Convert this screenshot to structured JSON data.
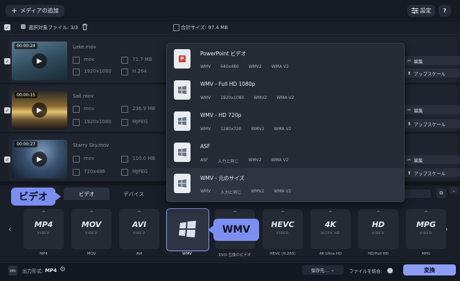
{
  "toolbar": {
    "add_media": "メディアの追加",
    "settings": "設定",
    "help": "?"
  },
  "selection": {
    "label": "選択対象ファイル: 3/3",
    "total": "合計サイズ: 97.4 MB"
  },
  "files": [
    {
      "time": "00:00:24",
      "name": "Lake.mov",
      "container": "mov",
      "resolution": "1920x1080",
      "size": "71.7 MB",
      "codec": "H.264"
    },
    {
      "time": "00:00:15",
      "name": "Sail.mov",
      "container": "mov",
      "resolution": "1920x1080",
      "size": "236.9 MB",
      "codec": "MJPEG"
    },
    {
      "time": "00:00:27",
      "name": "Starry Sky.mov",
      "container": "mov",
      "resolution": "720x486",
      "size": "110.0 MB",
      "codec": "MJPEG"
    }
  ],
  "row_actions": {
    "edit": "編集",
    "upscale": "アップスケール"
  },
  "dropdown": [
    {
      "title": "PowerPoint ビデオ",
      "specs": [
        "WMV",
        "640x480",
        "WMV2",
        "WMA V2"
      ]
    },
    {
      "title": "WMV - Full HD 1080p",
      "specs": [
        "WMV",
        "1920x1080",
        "WMV2",
        "WMA V2"
      ]
    },
    {
      "title": "WMV - HD 720p",
      "specs": [
        "WMV",
        "1280x720",
        "WMV2",
        "WMA V2"
      ]
    },
    {
      "title": "ASF",
      "specs": [
        "ASF",
        "入力と同じ",
        "WMV2",
        "WMA V2"
      ]
    },
    {
      "title": "WMV - 元のサイズ",
      "specs": [
        "WMV",
        "入力と同じ",
        "WMV2",
        "WMA V2"
      ]
    }
  ],
  "tabs": {
    "video": "ビデオ",
    "devices": "デバイス"
  },
  "callouts": {
    "video": "ビデオ",
    "wmv": "WMV"
  },
  "formats": [
    {
      "logo": "MP4",
      "sub": "VIDEO",
      "label": "MP4"
    },
    {
      "logo": "MOV",
      "sub": "VIDEO",
      "label": "MOV"
    },
    {
      "logo": "AVI",
      "sub": "VIDEO",
      "label": "AVI"
    },
    {
      "logo": "",
      "sub": "",
      "label": "WMV"
    },
    {
      "logo": "",
      "sub": "",
      "label": "DVD 互換のビデオ"
    },
    {
      "logo": "HEVC",
      "sub": "VIDEO",
      "label": "HEVC (H.265)"
    },
    {
      "logo": "4K",
      "sub": "ULTRA HD",
      "label": "4K Ultra HD"
    },
    {
      "logo": "HD",
      "sub": "VIDEO",
      "label": "HD/Full HD"
    },
    {
      "logo": "MPG",
      "sub": "VIDEO",
      "label": "MPG"
    }
  ],
  "footer": {
    "output_label": "出力形式:",
    "output_value": "MP4",
    "save_to": "保存先...",
    "merge": "ファイルを結合:",
    "convert": "変換"
  },
  "colors": {
    "accent": "#7c8ff0",
    "background": "#12151d",
    "panel": "#262a35",
    "convert_button": "#8d9cf5"
  }
}
